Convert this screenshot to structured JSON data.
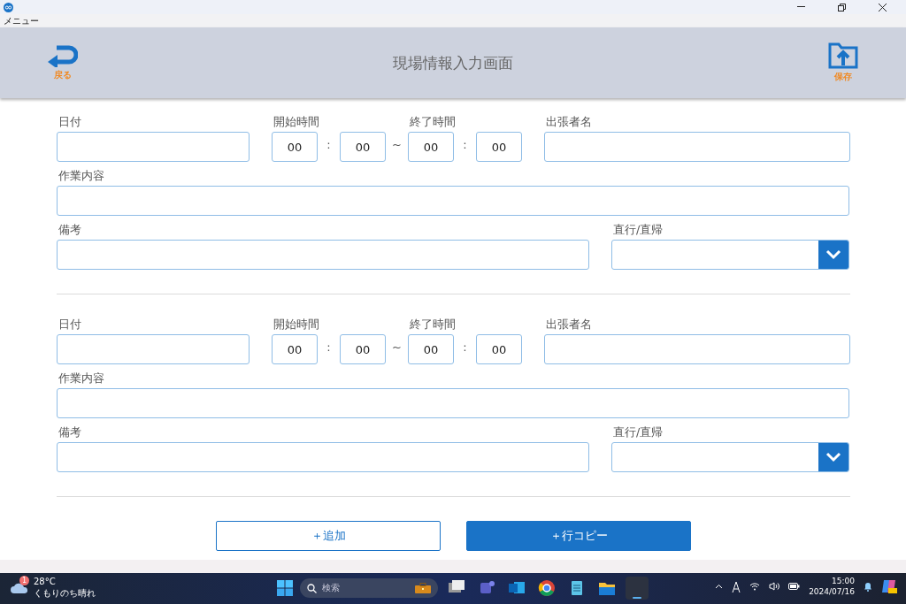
{
  "title_bar": {
    "menu": "メニュー"
  },
  "header": {
    "back": "戻る",
    "title": "現場情報入力画面",
    "save": "保存"
  },
  "sections": [
    {
      "date_label": "日付",
      "start_label": "開始時間",
      "start_hour": "00",
      "start_colon": ":",
      "start_minute": "00",
      "tilde": "~",
      "end_label": "終了時間",
      "end_hour": "00",
      "end_colon": ":",
      "end_minute": "00",
      "name_label": "出張者名",
      "work_label": "作業内容",
      "remarks_label": "備考",
      "direct_label": "直行/直帰"
    },
    {
      "date_label": "日付",
      "start_label": "開始時間",
      "start_hour": "00",
      "start_colon": ":",
      "start_minute": "00",
      "tilde": "~",
      "end_label": "終了時間",
      "end_hour": "00",
      "end_colon": ":",
      "end_minute": "00",
      "name_label": "出張者名",
      "work_label": "作業内容",
      "remarks_label": "備考",
      "direct_label": "直行/直帰"
    }
  ],
  "actions": [
    {
      "label": "＋追加",
      "kind": "outline"
    },
    {
      "label": "＋行コピー",
      "kind": "filled"
    }
  ],
  "taskbar": {
    "weather_badge": "1",
    "temperature": "28°C",
    "weather": "くもりのち晴れ",
    "search_placeholder": "検索",
    "apps": [
      {
        "kind": "taskview",
        "selected": false
      },
      {
        "kind": "teams",
        "selected": false
      },
      {
        "kind": "outlook",
        "selected": false
      },
      {
        "kind": "chrome",
        "selected": false
      },
      {
        "kind": "notepad",
        "selected": false
      },
      {
        "kind": "folder",
        "selected": false
      },
      {
        "kind": "blank",
        "selected": true
      }
    ],
    "time": "15:00",
    "date": "2024/07/16"
  }
}
